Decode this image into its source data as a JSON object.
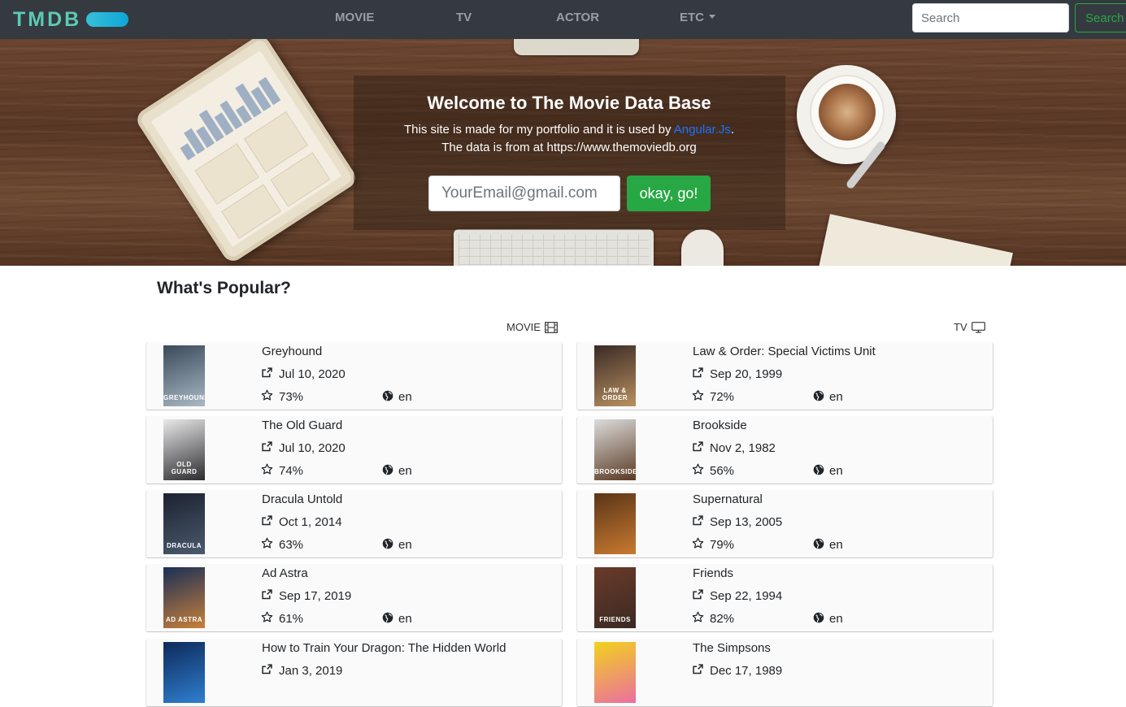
{
  "navbar": {
    "brand": "TMDB",
    "links": [
      "MOVIE",
      "TV",
      "ACTOR",
      "ETC"
    ],
    "search_placeholder": "Search",
    "search_button": "Search"
  },
  "hero": {
    "title": "Welcome to The Movie Data Base",
    "line1_prefix": "This site is made for my portfolio and it is used by ",
    "line1_link": "Angular.Js",
    "line1_suffix": ".",
    "line2": "The data is from at https://www.themoviedb.org",
    "email_placeholder": "YourEmail@gmail.com",
    "go_button": "okay, go!"
  },
  "popular": {
    "title": "What's Popular?",
    "movie_label": "MOVIE",
    "tv_label": "TV",
    "movies": [
      {
        "title": "Greyhound",
        "date": "Jul 10, 2020",
        "rating": "73%",
        "lang": "en",
        "poster_text": "GREYHOUND",
        "poster_colors": [
          "#3a4a5a",
          "#a9b8c4"
        ]
      },
      {
        "title": "The Old Guard",
        "date": "Jul 10, 2020",
        "rating": "74%",
        "lang": "en",
        "poster_text": "OLD GUARD",
        "poster_colors": [
          "#e9e9e9",
          "#2b2b30"
        ]
      },
      {
        "title": "Dracula Untold",
        "date": "Oct 1, 2014",
        "rating": "63%",
        "lang": "en",
        "poster_text": "DRACULA",
        "poster_colors": [
          "#1c2230",
          "#4a5a6e"
        ]
      },
      {
        "title": "Ad Astra",
        "date": "Sep 17, 2019",
        "rating": "61%",
        "lang": "en",
        "poster_text": "AD ASTRA",
        "poster_colors": [
          "#1a2f57",
          "#c8803a"
        ]
      },
      {
        "title": "How to Train Your Dragon: The Hidden World",
        "date": "Jan 3, 2019",
        "rating": "",
        "lang": "",
        "poster_text": "",
        "poster_colors": [
          "#0d2a5a",
          "#2f7fd0"
        ]
      }
    ],
    "tv": [
      {
        "title": "Law & Order: Special Victims Unit",
        "date": "Sep 20, 1999",
        "rating": "72%",
        "lang": "en",
        "poster_text": "LAW & ORDER",
        "poster_colors": [
          "#3a2a25",
          "#b89060"
        ]
      },
      {
        "title": "Brookside",
        "date": "Nov 2, 1982",
        "rating": "56%",
        "lang": "en",
        "poster_text": "BROOKSIDE",
        "poster_colors": [
          "#dcdcdc",
          "#5a3a22"
        ]
      },
      {
        "title": "Supernatural",
        "date": "Sep 13, 2005",
        "rating": "79%",
        "lang": "en",
        "poster_text": "",
        "poster_colors": [
          "#5a3518",
          "#c97a30"
        ]
      },
      {
        "title": "Friends",
        "date": "Sep 22, 1994",
        "rating": "82%",
        "lang": "en",
        "poster_text": "FRIENDS",
        "poster_colors": [
          "#6a3a2a",
          "#3a2a22"
        ]
      },
      {
        "title": "The Simpsons",
        "date": "Dec 17, 1989",
        "rating": "",
        "lang": "",
        "poster_text": "",
        "poster_colors": [
          "#f2d21e",
          "#ea6fa0"
        ]
      }
    ]
  },
  "colors": {
    "navbar_bg": "#343a40",
    "accent_green": "#28a745",
    "link_blue": "#1a73ff",
    "brand_teal": "#5ccab4"
  }
}
